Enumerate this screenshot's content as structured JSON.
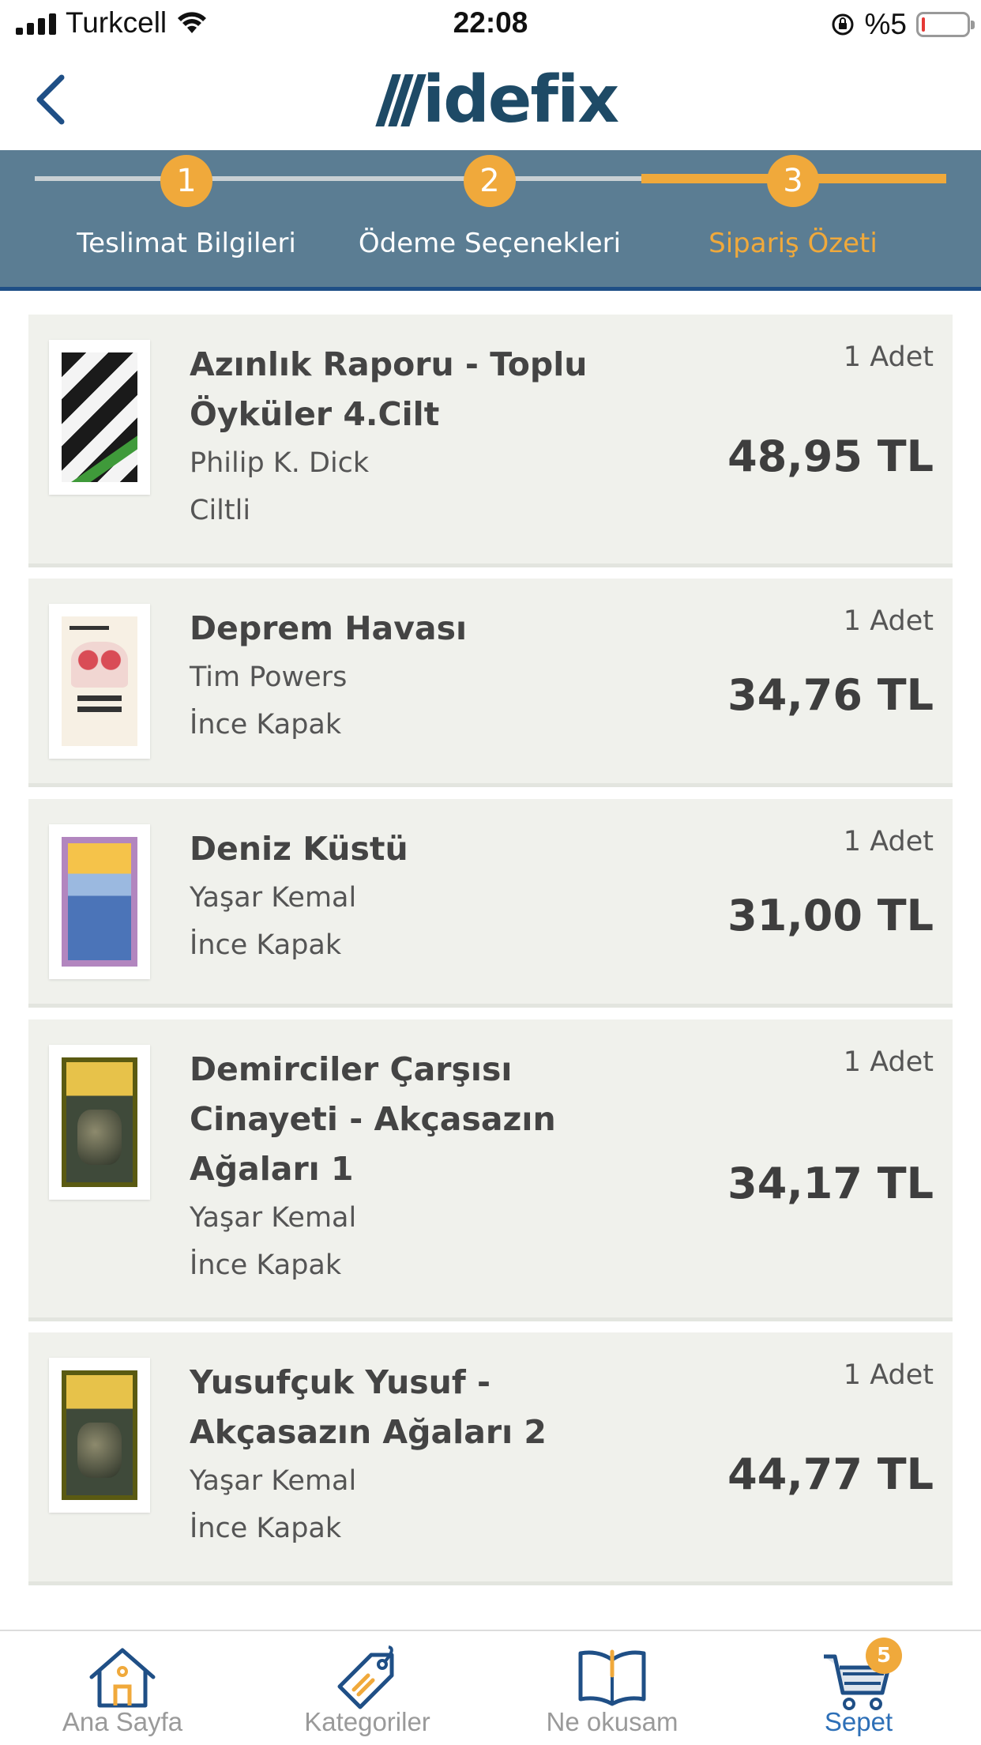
{
  "status_bar": {
    "carrier": "Turkcell",
    "time": "22:08",
    "battery": "%5"
  },
  "header": {
    "back_icon": "chevron-left-icon",
    "logo": "idefix",
    "brand_color": "#1e4a66"
  },
  "stepper": {
    "steps": [
      {
        "number": "1",
        "label": "Teslimat Bilgileri"
      },
      {
        "number": "2",
        "label": "Ödeme Seçenekleri"
      },
      {
        "number": "3",
        "label": "Sipariş Özeti"
      }
    ],
    "active_step": 3,
    "accent_color": "#f0a93b",
    "background_color": "#5b7d93"
  },
  "cart": {
    "items": [
      {
        "title_lines": [
          "Azınlık Raporu - Toplu",
          "Öyküler 4.Cilt"
        ],
        "author": "Philip K. Dick",
        "binding": "Ciltli",
        "quantity": "1 Adet",
        "price": "48,95 TL"
      },
      {
        "title_lines": [
          "Deprem Havası"
        ],
        "author": "Tim Powers",
        "binding": "İnce Kapak",
        "quantity": "1 Adet",
        "price": "34,76 TL"
      },
      {
        "title_lines": [
          "Deniz Küstü"
        ],
        "author": "Yaşar Kemal",
        "binding": "İnce Kapak",
        "quantity": "1 Adet",
        "price": "31,00 TL"
      },
      {
        "title_lines": [
          "Demirciler Çarşısı",
          "Cinayeti - Akçasazın",
          "Ağaları 1"
        ],
        "author": "Yaşar Kemal",
        "binding": "İnce Kapak",
        "quantity": "1 Adet",
        "price": "34,17 TL"
      },
      {
        "title_lines": [
          "Yusufçuk Yusuf -",
          "Akçasazın Ağaları 2"
        ],
        "author": "Yaşar Kemal",
        "binding": "İnce Kapak",
        "quantity": "1 Adet",
        "price": "44,77 TL"
      }
    ]
  },
  "tabbar": {
    "tabs": [
      {
        "label": "Ana Sayfa",
        "icon": "home-icon"
      },
      {
        "label": "Kategoriler",
        "icon": "tag-icon"
      },
      {
        "label": "Ne okusam",
        "icon": "book-icon"
      },
      {
        "label": "Sepet",
        "icon": "cart-icon",
        "badge": "5"
      }
    ],
    "active_tab": "Sepet",
    "active_color": "#2d6fb7"
  }
}
